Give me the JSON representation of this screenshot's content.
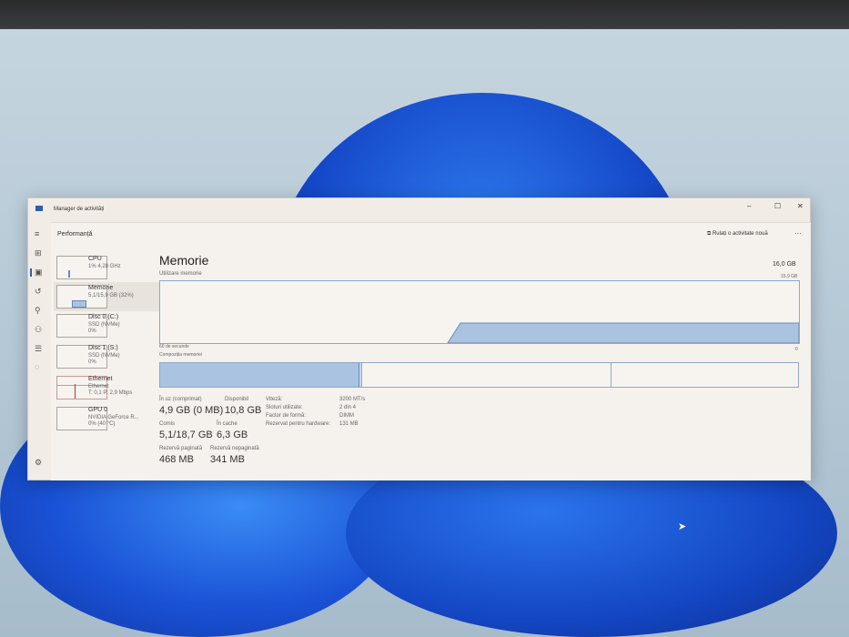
{
  "window": {
    "title": "Manager de activități",
    "minimize": "–",
    "maximize": "☐",
    "close": "✕"
  },
  "header": {
    "section": "Performanță",
    "run_task": "Rulați o activitate nouă",
    "more": "···"
  },
  "sidebar": {
    "items": [
      {
        "name": "CPU",
        "sub1": "1% 4,28 GHz",
        "sub2": ""
      },
      {
        "name": "Memorie",
        "sub1": "5,1/15,9 GB (32%)",
        "sub2": ""
      },
      {
        "name": "Disc 0 (C:)",
        "sub1": "SSD (NVMe)",
        "sub2": "0%"
      },
      {
        "name": "Disc 1 (S:)",
        "sub1": "SSD (NVMe)",
        "sub2": "0%"
      },
      {
        "name": "Ethernet",
        "sub1": "Ethernet",
        "sub2": "T: 0,1 P: 2,9 Mbps"
      },
      {
        "name": "GPU 0",
        "sub1": "NVIDIA GeForce R...",
        "sub2": "0% (40 °C)"
      }
    ]
  },
  "main": {
    "title": "Memorie",
    "total": "16,0 GB",
    "usage_label": "Utilizare memorie",
    "usage_max": "15,9 GB",
    "time_label": "60 de secunde",
    "time_min": "0",
    "composition_label": "Compoziția memoriei",
    "usage_fraction": 0.32,
    "stats": {
      "in_use_label": "În uz (comprimat)",
      "in_use": "4,9 GB (0 MB)",
      "available_label": "Disponibil",
      "available": "10,8 GB",
      "committed_label": "Comis",
      "committed": "5,1/18,7 GB",
      "cached_label": "În cache",
      "cached": "6,3 GB",
      "paged_label": "Rezervă paginată",
      "paged": "468 MB",
      "nonpaged_label": "Rezervă nepaginată",
      "nonpaged": "341 MB"
    },
    "specs": [
      {
        "k": "Viteză:",
        "v": "3200 MT/s"
      },
      {
        "k": "Sloturi utilizate:",
        "v": "2 din 4"
      },
      {
        "k": "Factor de formă:",
        "v": "DIMM"
      },
      {
        "k": "Rezervat pentru hardware:",
        "v": "131 MB"
      }
    ]
  },
  "colors": {
    "accent": "#a9c3e0",
    "border": "#8fa8c8",
    "wallpaper": "#1f5ee0"
  }
}
